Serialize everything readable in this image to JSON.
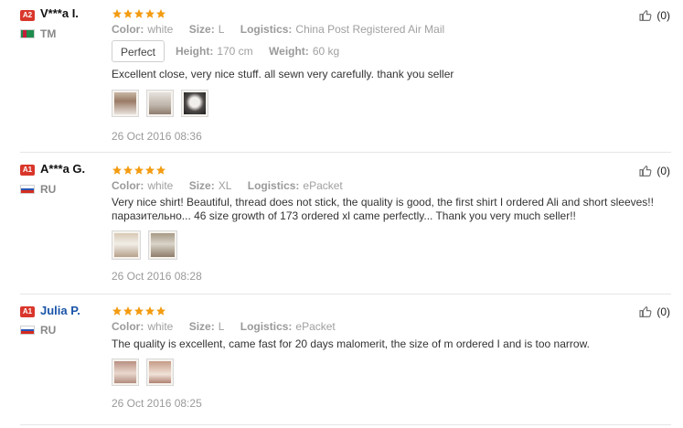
{
  "reviews": [
    {
      "badge": "A2",
      "name": "V***a I.",
      "country": "TM",
      "rating": 5,
      "meta": {
        "color_label": "Color:",
        "color_value": "white",
        "size_label": "Size:",
        "size_value": "L",
        "logistics_label": "Logistics:",
        "logistics_value": "China Post Registered Air Mail"
      },
      "fit_tag": "Perfect",
      "height_label": "Height:",
      "height_value": "170 cm",
      "weight_label": "Weight:",
      "weight_value": "60 kg",
      "text": "Excellent close, very nice stuff. all sewn very carefully. thank you seller",
      "photos": [
        "photo-1",
        "photo-2",
        "photo-3"
      ],
      "date": "26 Oct 2016 08:36",
      "helpful_count": "(0)"
    },
    {
      "badge": "A1",
      "name": "A***a G.",
      "country": "RU",
      "rating": 5,
      "meta": {
        "color_label": "Color:",
        "color_value": "white",
        "size_label": "Size:",
        "size_value": "XL",
        "logistics_label": "Logistics:",
        "logistics_value": "ePacket"
      },
      "text": "Very nice shirt! Beautiful, thread does not stick, the quality is good, the first shirt I ordered Ali and short sleeves!! паразительно... 46 size growth of 173 ordered xl came perfectly... Thank you very much seller!!",
      "photos": [
        "photo-1",
        "photo-2"
      ],
      "date": "26 Oct 2016 08:28",
      "helpful_count": "(0)"
    },
    {
      "badge": "A1",
      "name": "Julia P.",
      "country": "RU",
      "rating": 5,
      "meta": {
        "color_label": "Color:",
        "color_value": "white",
        "size_label": "Size:",
        "size_value": "L",
        "logistics_label": "Logistics:",
        "logistics_value": "ePacket"
      },
      "text": "The quality is excellent, came fast for 20 days malomerit, the size of m ordered I and is too narrow.",
      "photos": [
        "photo-1",
        "photo-2"
      ],
      "date": "26 Oct 2016 08:25",
      "helpful_count": "(0)"
    }
  ],
  "icons": {
    "star": "star-icon",
    "thumbs_up": "thumbs-up-icon",
    "flag_tm": "flag-turkmenistan-icon",
    "flag_ru": "flag-russia-icon"
  },
  "colors": {
    "badge_red": "#d9362b",
    "star_orange": "#f39c12",
    "name_blue": "#1a55a8",
    "separator": "#e6e6e6"
  }
}
